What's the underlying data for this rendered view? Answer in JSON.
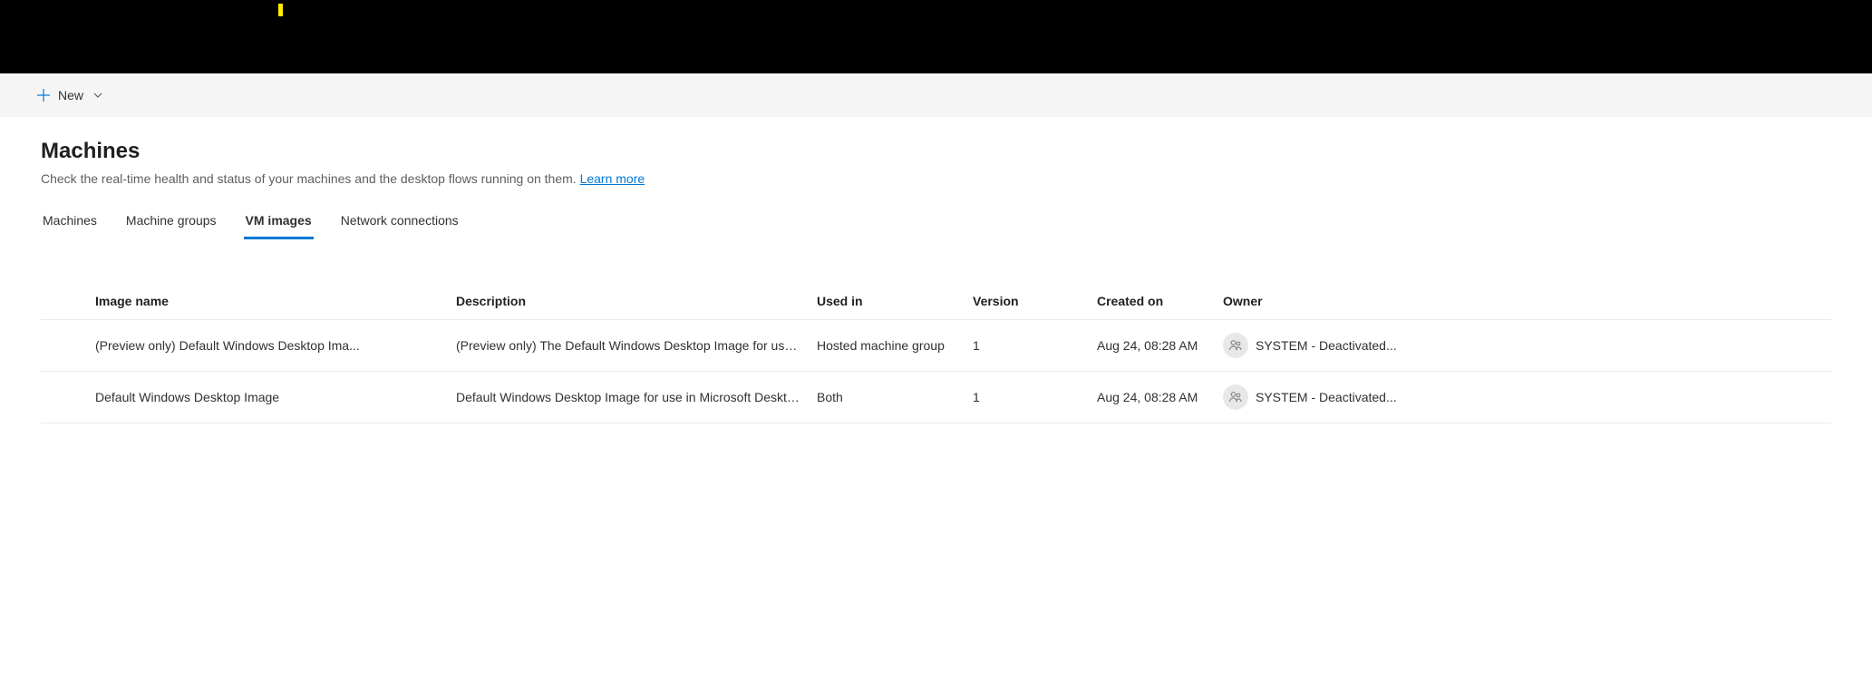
{
  "commandBar": {
    "newLabel": "New"
  },
  "page": {
    "title": "Machines",
    "subtitle": "Check the real-time health and status of your machines and the desktop flows running on them. ",
    "learnMore": "Learn more"
  },
  "tabs": {
    "machines": "Machines",
    "machineGroups": "Machine groups",
    "vmImages": "VM images",
    "networkConnections": "Network connections"
  },
  "table": {
    "headers": {
      "imageName": "Image name",
      "description": "Description",
      "usedIn": "Used in",
      "version": "Version",
      "createdOn": "Created on",
      "owner": "Owner"
    },
    "rows": [
      {
        "imageName": "(Preview only) Default Windows Desktop Ima...",
        "description": "(Preview only) The Default Windows Desktop Image for use i...",
        "usedIn": "Hosted machine group",
        "version": "1",
        "createdOn": "Aug 24, 08:28 AM",
        "owner": "SYSTEM - Deactivated..."
      },
      {
        "imageName": "Default Windows Desktop Image",
        "description": "Default Windows Desktop Image for use in Microsoft Deskto...",
        "usedIn": "Both",
        "version": "1",
        "createdOn": "Aug 24, 08:28 AM",
        "owner": "SYSTEM - Deactivated..."
      }
    ]
  }
}
